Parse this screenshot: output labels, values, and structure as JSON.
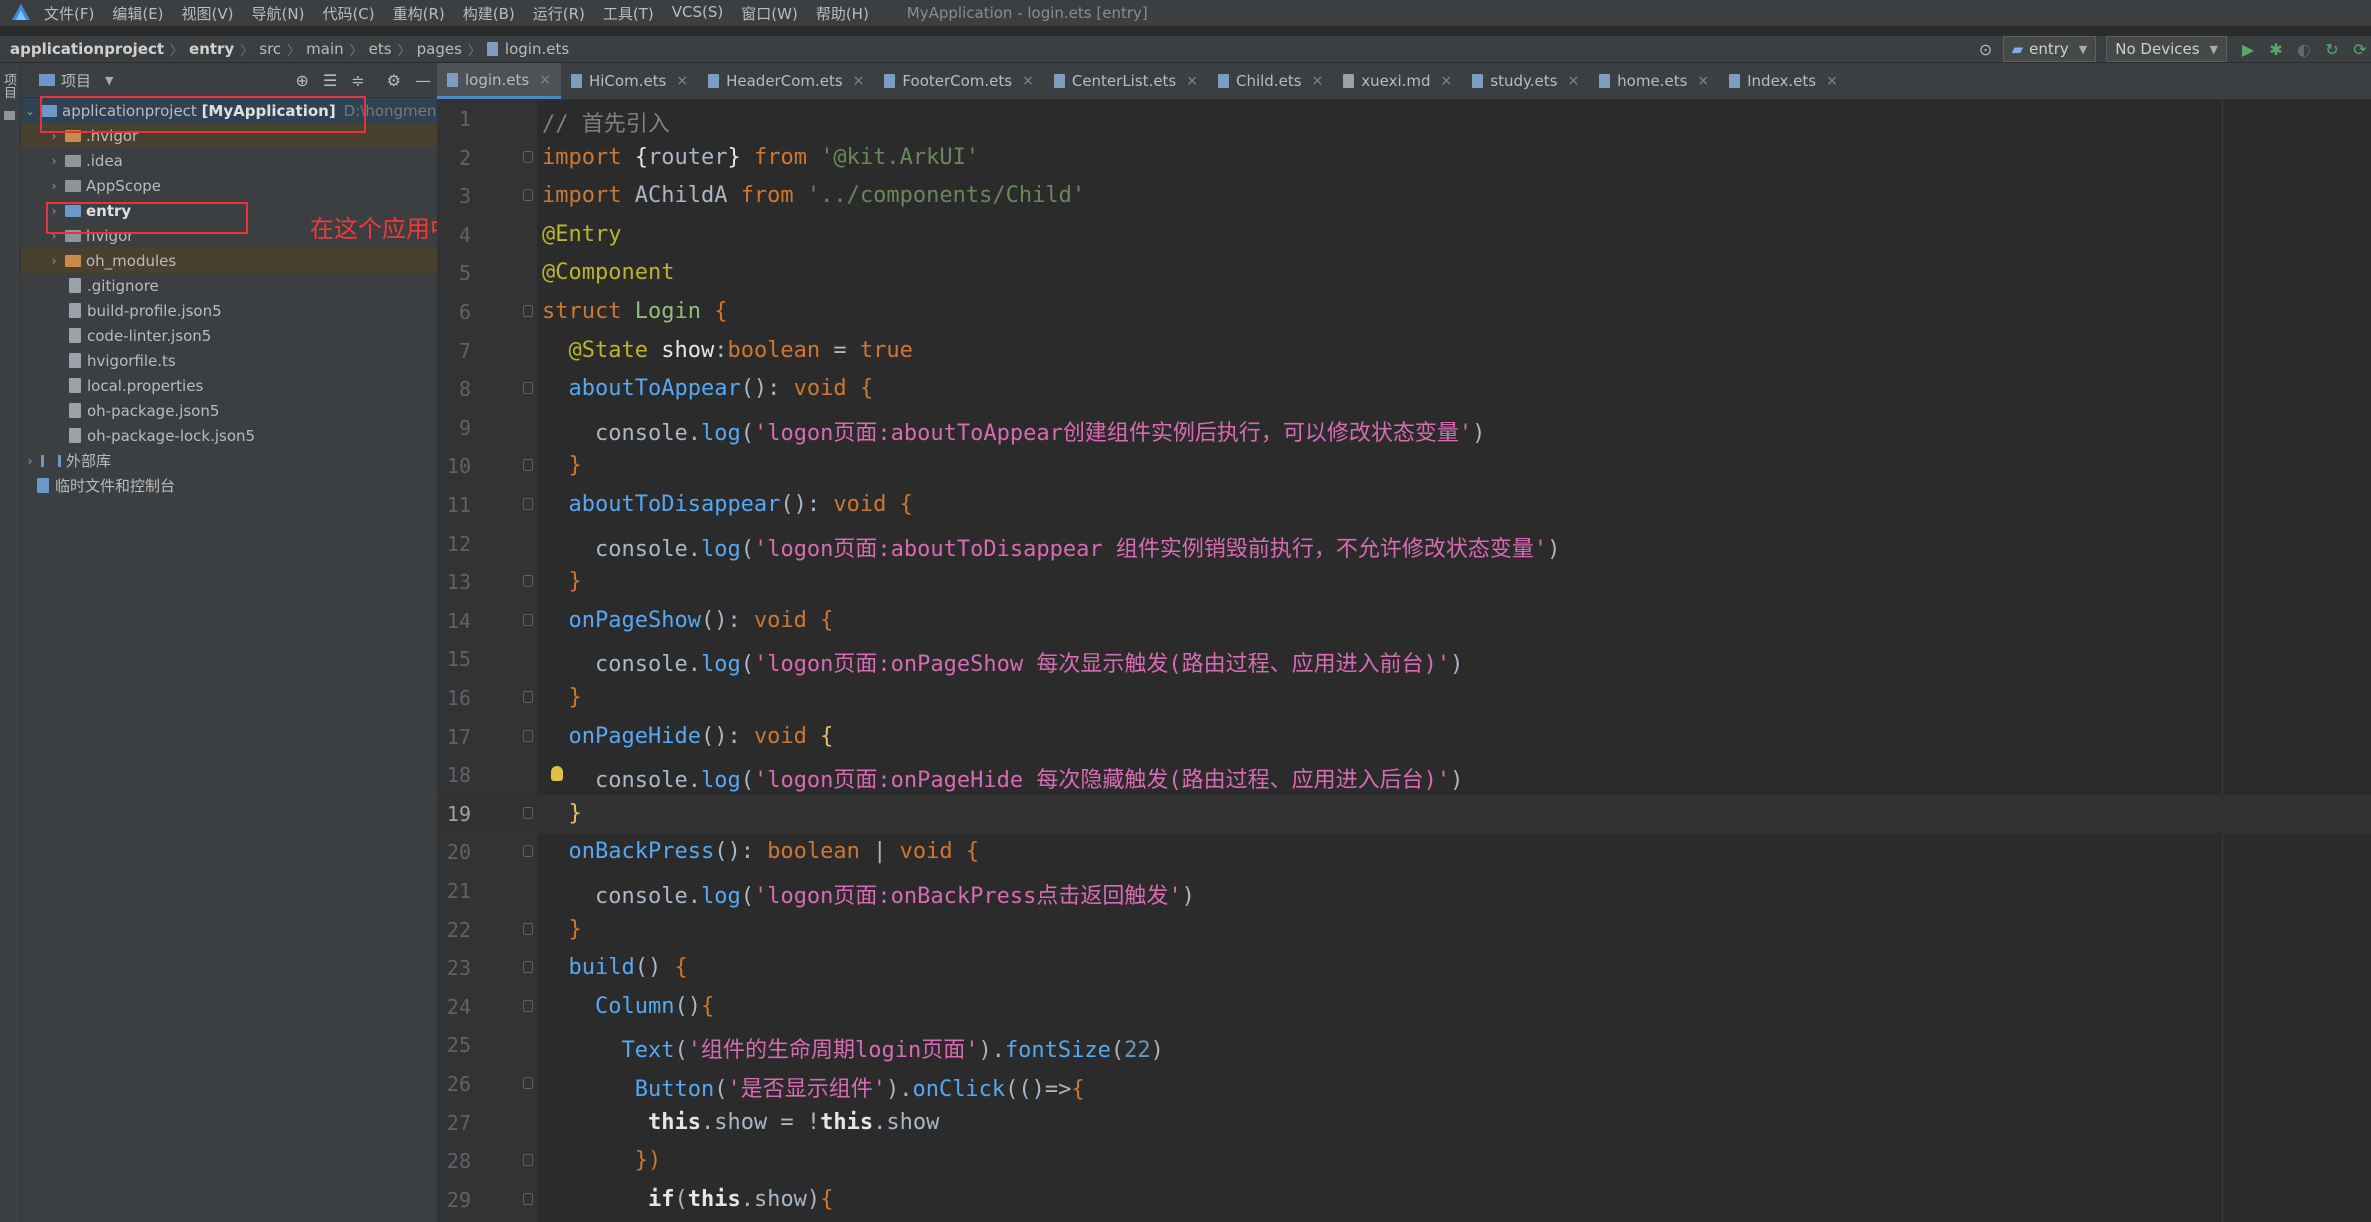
{
  "menu": {
    "items": [
      "文件(F)",
      "编辑(E)",
      "视图(V)",
      "导航(N)",
      "代码(C)",
      "重构(R)",
      "构建(B)",
      "运行(R)",
      "工具(T)",
      "VCS(S)",
      "窗口(W)",
      "帮助(H)"
    ],
    "window_title": "MyApplication - login.ets [entry]"
  },
  "breadcrumb": [
    "applicationproject",
    "entry",
    "src",
    "main",
    "ets",
    "pages",
    "login.ets"
  ],
  "toolbar": {
    "run_config": "entry",
    "device": "No Devices"
  },
  "side_stripe": {
    "label": "项目"
  },
  "project_panel": {
    "title": "项目",
    "root": {
      "name": "applicationproject [MyApplication]",
      "path": "D:\\hongmen"
    },
    "items": [
      {
        "name": ".hvigor",
        "kind": "folder-orange",
        "expandable": true,
        "highlight": true
      },
      {
        "name": ".idea",
        "kind": "folder",
        "expandable": true,
        "highlight": false
      },
      {
        "name": "AppScope",
        "kind": "folder",
        "expandable": true,
        "highlight": false
      },
      {
        "name": "entry",
        "kind": "folder-blue",
        "expandable": true,
        "highlight": false,
        "bold": true
      },
      {
        "name": "hvigor",
        "kind": "folder",
        "expandable": true,
        "highlight": false
      },
      {
        "name": "oh_modules",
        "kind": "folder-orange",
        "expandable": true,
        "highlight": true
      },
      {
        "name": ".gitignore",
        "kind": "file",
        "expandable": false,
        "highlight": false
      },
      {
        "name": "build-profile.json5",
        "kind": "file",
        "expandable": false,
        "highlight": false
      },
      {
        "name": "code-linter.json5",
        "kind": "file",
        "expandable": false,
        "highlight": false
      },
      {
        "name": "hvigorfile.ts",
        "kind": "file",
        "expandable": false,
        "highlight": false
      },
      {
        "name": "local.properties",
        "kind": "file",
        "expandable": false,
        "highlight": false
      },
      {
        "name": "oh-package.json5",
        "kind": "file",
        "expandable": false,
        "highlight": false
      },
      {
        "name": "oh-package-lock.json5",
        "kind": "file",
        "expandable": false,
        "highlight": false
      }
    ],
    "external_libs": "外部库",
    "scratches": "临时文件和控制台"
  },
  "annotation": "在这个应用中，我们目前可以把一个entry看作成为一个模块",
  "tabs": [
    {
      "label": "login.ets",
      "active": true
    },
    {
      "label": "HiCom.ets",
      "active": false
    },
    {
      "label": "HeaderCom.ets",
      "active": false
    },
    {
      "label": "FooterCom.ets",
      "active": false
    },
    {
      "label": "CenterList.ets",
      "active": false
    },
    {
      "label": "Child.ets",
      "active": false
    },
    {
      "label": "xuexi.md",
      "active": false
    },
    {
      "label": "study.ets",
      "active": false
    },
    {
      "label": "home.ets",
      "active": false
    },
    {
      "label": "Index.ets",
      "active": false
    }
  ],
  "editor": {
    "current_line": 19,
    "lines": [
      {
        "n": "1",
        "t": [
          [
            "com",
            "// 首先引入"
          ]
        ]
      },
      {
        "n": "2",
        "t": [
          [
            "kw",
            "import "
          ],
          [
            "white",
            "{"
          ],
          [
            "plain",
            "router"
          ],
          [
            "white",
            "} "
          ],
          [
            "kw",
            "from "
          ],
          [
            "str",
            "'@kit.ArkUI'"
          ]
        ]
      },
      {
        "n": "3",
        "t": [
          [
            "kw",
            "import "
          ],
          [
            "plain",
            "AChildA "
          ],
          [
            "kw",
            "from "
          ],
          [
            "str",
            "'../components/Child'"
          ]
        ]
      },
      {
        "n": "4",
        "t": [
          [
            "ann",
            "@Entry"
          ]
        ]
      },
      {
        "n": "5",
        "t": [
          [
            "ann",
            "@Component"
          ]
        ]
      },
      {
        "n": "6",
        "t": [
          [
            "kw",
            "struct "
          ],
          [
            "green",
            "Login "
          ],
          [
            "kw",
            "{"
          ]
        ]
      },
      {
        "n": "7",
        "t": [
          [
            "plain",
            "  "
          ],
          [
            "ann",
            "@State "
          ],
          [
            "white",
            "show"
          ],
          [
            "plain",
            ":"
          ],
          [
            "kw",
            "boolean "
          ],
          [
            "plain",
            "= "
          ],
          [
            "kw",
            "true"
          ]
        ]
      },
      {
        "n": "8",
        "t": [
          [
            "plain",
            "  "
          ],
          [
            "fn",
            "aboutToAppear"
          ],
          [
            "plain",
            "(): "
          ],
          [
            "kw",
            "void "
          ],
          [
            "kw",
            "{"
          ]
        ]
      },
      {
        "n": "9",
        "t": [
          [
            "plain",
            "    console."
          ],
          [
            "fn",
            "log"
          ],
          [
            "plain",
            "("
          ],
          [
            "str2",
            "'logon页面:aboutToAppear创建组件实例后执行，可以修改状态变量'"
          ],
          [
            "plain",
            ")"
          ]
        ]
      },
      {
        "n": "10",
        "t": [
          [
            "plain",
            "  "
          ],
          [
            "kw",
            "}"
          ]
        ]
      },
      {
        "n": "11",
        "t": [
          [
            "plain",
            "  "
          ],
          [
            "fn",
            "aboutToDisappear"
          ],
          [
            "plain",
            "(): "
          ],
          [
            "kw",
            "void "
          ],
          [
            "kw",
            "{"
          ]
        ]
      },
      {
        "n": "12",
        "t": [
          [
            "plain",
            "    console."
          ],
          [
            "fn",
            "log"
          ],
          [
            "plain",
            "("
          ],
          [
            "str2",
            "'logon页面:aboutToDisappear 组件实例销毁前执行，不允许修改状态变量'"
          ],
          [
            "plain",
            ")"
          ]
        ]
      },
      {
        "n": "13",
        "t": [
          [
            "plain",
            "  "
          ],
          [
            "kw",
            "}"
          ]
        ]
      },
      {
        "n": "14",
        "t": [
          [
            "plain",
            "  "
          ],
          [
            "fn",
            "onPageShow"
          ],
          [
            "plain",
            "(): "
          ],
          [
            "kw",
            "void "
          ],
          [
            "kw",
            "{"
          ]
        ]
      },
      {
        "n": "15",
        "t": [
          [
            "plain",
            "    console."
          ],
          [
            "fn",
            "log"
          ],
          [
            "plain",
            "("
          ],
          [
            "str2",
            "'logon页面:onPageShow 每次显示触发(路由过程、应用进入前台)'"
          ],
          [
            "plain",
            ")"
          ]
        ]
      },
      {
        "n": "16",
        "t": [
          [
            "plain",
            "  "
          ],
          [
            "kw",
            "}"
          ]
        ]
      },
      {
        "n": "17",
        "t": [
          [
            "plain",
            "  "
          ],
          [
            "fn",
            "onPageHide"
          ],
          [
            "plain",
            "(): "
          ],
          [
            "kw",
            "void "
          ],
          [
            "kwb",
            "{"
          ]
        ]
      },
      {
        "n": "18",
        "t": [
          [
            "plain",
            "    console."
          ],
          [
            "fn",
            "log"
          ],
          [
            "plain",
            "("
          ],
          [
            "str2",
            "'logon页面:onPageHide 每次隐藏触发(路由过程、应用进入后台)'"
          ],
          [
            "plain",
            ")"
          ]
        ]
      },
      {
        "n": "19",
        "t": [
          [
            "plain",
            "  "
          ],
          [
            "kwb",
            "}"
          ]
        ]
      },
      {
        "n": "20",
        "t": [
          [
            "plain",
            "  "
          ],
          [
            "fn",
            "onBackPress"
          ],
          [
            "plain",
            "(): "
          ],
          [
            "kw",
            "boolean "
          ],
          [
            "plain",
            "| "
          ],
          [
            "kw",
            "void "
          ],
          [
            "kw",
            "{"
          ]
        ]
      },
      {
        "n": "21",
        "t": [
          [
            "plain",
            "    console."
          ],
          [
            "fn",
            "log"
          ],
          [
            "plain",
            "("
          ],
          [
            "str2",
            "'logon页面:onBackPress点击返回触发'"
          ],
          [
            "plain",
            ")"
          ]
        ]
      },
      {
        "n": "22",
        "t": [
          [
            "plain",
            "  "
          ],
          [
            "kw",
            "}"
          ]
        ]
      },
      {
        "n": "23",
        "t": [
          [
            "plain",
            "  "
          ],
          [
            "fn",
            "build"
          ],
          [
            "plain",
            "() "
          ],
          [
            "kw",
            "{"
          ]
        ]
      },
      {
        "n": "24",
        "t": [
          [
            "plain",
            "    "
          ],
          [
            "fn",
            "Column"
          ],
          [
            "plain",
            "()"
          ],
          [
            "kw",
            "{"
          ]
        ]
      },
      {
        "n": "25",
        "t": [
          [
            "plain",
            "      "
          ],
          [
            "fn",
            "Text"
          ],
          [
            "plain",
            "("
          ],
          [
            "str2",
            "'组件的生命周期login页面'"
          ],
          [
            "plain",
            ")."
          ],
          [
            "fn",
            "fontSize"
          ],
          [
            "plain",
            "("
          ],
          [
            "num",
            "22"
          ],
          [
            "plain",
            ")"
          ]
        ]
      },
      {
        "n": "26",
        "t": [
          [
            "plain",
            "       "
          ],
          [
            "fn",
            "Button"
          ],
          [
            "plain",
            "("
          ],
          [
            "str2",
            "'是否显示组件'"
          ],
          [
            "plain",
            ")."
          ],
          [
            "fn",
            "onClick"
          ],
          [
            "plain",
            "(()=>"
          ],
          [
            "kw",
            "{"
          ]
        ]
      },
      {
        "n": "27",
        "t": [
          [
            "plain",
            "        "
          ],
          [
            "bold",
            "this"
          ],
          [
            "plain",
            ".show = !"
          ],
          [
            "bold",
            "this"
          ],
          [
            "plain",
            ".show"
          ]
        ]
      },
      {
        "n": "28",
        "t": [
          [
            "plain",
            "       "
          ],
          [
            "kw",
            "})"
          ]
        ]
      },
      {
        "n": "29",
        "t": [
          [
            "plain",
            "        "
          ],
          [
            "bold",
            "if"
          ],
          [
            "plain",
            "("
          ],
          [
            "bold",
            "this"
          ],
          [
            "plain",
            ".show)"
          ],
          [
            "kw",
            "{"
          ]
        ]
      }
    ]
  }
}
